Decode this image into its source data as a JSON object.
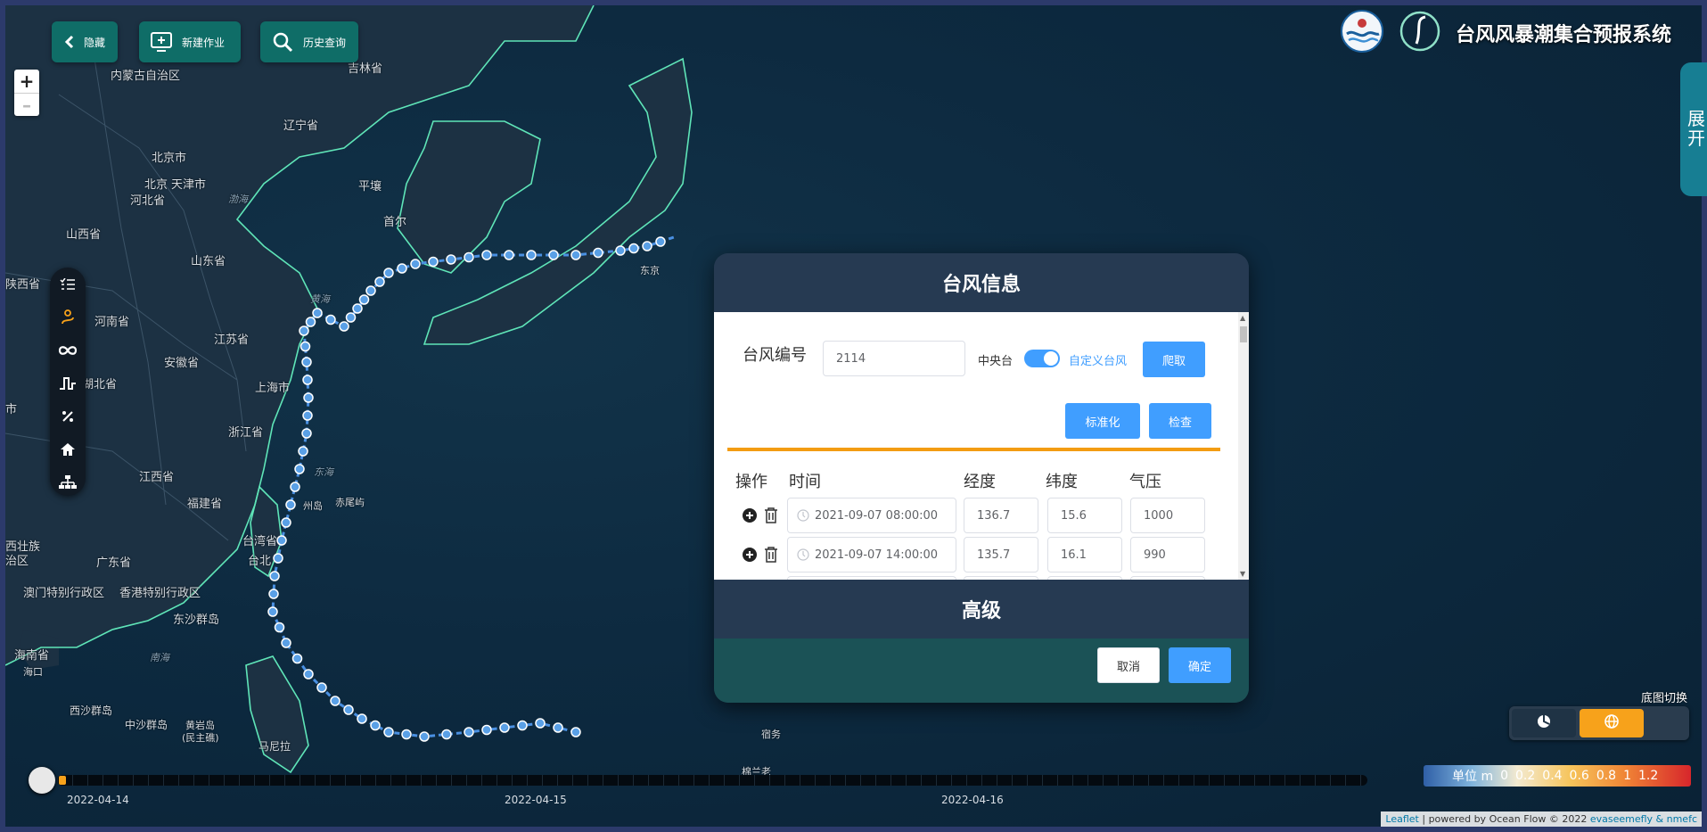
{
  "top_buttons": {
    "hide": "隐藏",
    "new_job": "新建作业",
    "history": "历史查询"
  },
  "brand": {
    "title": "台风风暴潮集合预报系统"
  },
  "expand_label": [
    "展",
    "开"
  ],
  "map_labels": {
    "land": [
      "内蒙古自治区",
      "吉林省",
      "辽宁省",
      "北京市",
      "北京",
      "天津市",
      "河北省",
      "山西省",
      "平壤",
      "首尔",
      "山东省",
      "陕西省",
      "河南省",
      "江苏省",
      "安徽省",
      "湖北省",
      "上海市",
      "浙江省",
      "江西省",
      "市",
      "福建省",
      "台湾省",
      "台北",
      "西壮族",
      "治区",
      "广东省",
      "澳门特别行政区",
      "香港特别行政区",
      "东沙群岛",
      "海南省",
      "海口",
      "西沙群岛",
      "中沙群岛",
      "黄岩岛",
      "(民主礁)",
      "马尼拉",
      "宿务",
      "棉兰老",
      "东京",
      "州岛",
      "赤尾屿"
    ],
    "sea": [
      "渤海",
      "黄海",
      "东海",
      "南海"
    ]
  },
  "toolbar_icons": [
    "list-icon",
    "route-icon",
    "infinity-icon",
    "step-icon",
    "percent-icon",
    "home-icon",
    "hierarchy-icon"
  ],
  "dialog": {
    "title": "台风信息",
    "typhoon_no_label": "台风编号",
    "typhoon_no_value": "2114",
    "toggle_left": "中央台",
    "toggle_right": "自定义台风",
    "fetch_button": "爬取",
    "normalize_button": "标准化",
    "check_button": "检查",
    "columns": [
      "操作",
      "时间",
      "经度",
      "纬度",
      "气压"
    ],
    "rows": [
      {
        "time": "2021-09-07 08:00:00",
        "lon": "136.7",
        "lat": "15.6",
        "pressure": "1000"
      },
      {
        "time": "2021-09-07 14:00:00",
        "lon": "135.7",
        "lat": "16.1",
        "pressure": "990"
      }
    ],
    "advanced_label": "高级",
    "cancel_button": "取消",
    "confirm_button": "确定"
  },
  "basemap": {
    "label": "底图切换"
  },
  "legend": {
    "unit": "单位 m",
    "values": [
      "0",
      "0.2",
      "0.4",
      "0.6",
      "0.8",
      "1",
      "1.2"
    ]
  },
  "timeline": {
    "dates": [
      "2022-04-14",
      "2022-04-15",
      "2022-04-16"
    ]
  },
  "attribution": {
    "leaflet": "Leaflet",
    "text": " | powered by Ocean Flow © 2022 ",
    "link": "evaseemefly & nmefc"
  },
  "colors": {
    "accent": "#409eff",
    "teal": "#0f6d67",
    "orange": "#f7a21b",
    "coast": "#5fe5b8"
  }
}
